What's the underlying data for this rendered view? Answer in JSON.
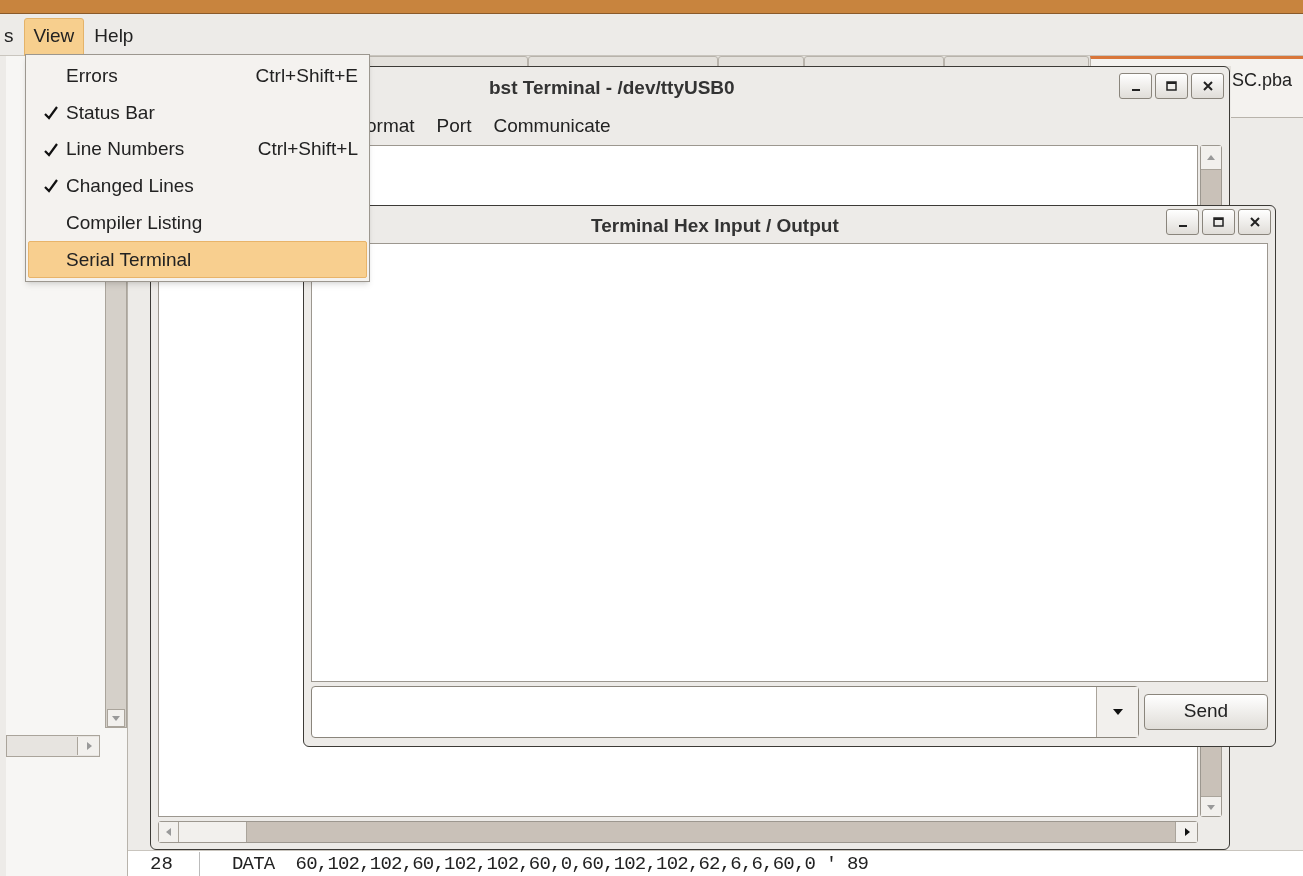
{
  "main_menu": [
    {
      "label": "s",
      "selected": false
    },
    {
      "label": "View",
      "selected": true
    },
    {
      "label": "Help",
      "selected": false
    }
  ],
  "view_menu": [
    {
      "label": "Errors",
      "shortcut": "Ctrl+Shift+E",
      "checked": false,
      "selected": false
    },
    {
      "label": "Status Bar",
      "checked": true,
      "selected": false
    },
    {
      "label": "Line Numbers",
      "shortcut": "Ctrl+Shift+L",
      "checked": true,
      "selected": false
    },
    {
      "label": "Changed Lines",
      "checked": true,
      "selected": false
    },
    {
      "label": "Compiler Listing",
      "checked": false,
      "selected": false
    },
    {
      "label": "Serial Terminal",
      "checked": false,
      "selected": true
    }
  ],
  "editor_tab": {
    "label": "SC.pba",
    "selected": true
  },
  "editor": {
    "lines": [
      {
        "number": "28",
        "code": "DATA  60,102,102,60,102,102,60,0,60,102,102,62,6,6,60,0 ' 89"
      }
    ]
  },
  "terminal_window": {
    "title": "bst Terminal - /dev/ttyUSB0",
    "menu": [
      "ormat",
      "Port",
      "Communicate"
    ]
  },
  "hex_window": {
    "title": "Terminal Hex Input / Output",
    "send_button": "Send"
  }
}
